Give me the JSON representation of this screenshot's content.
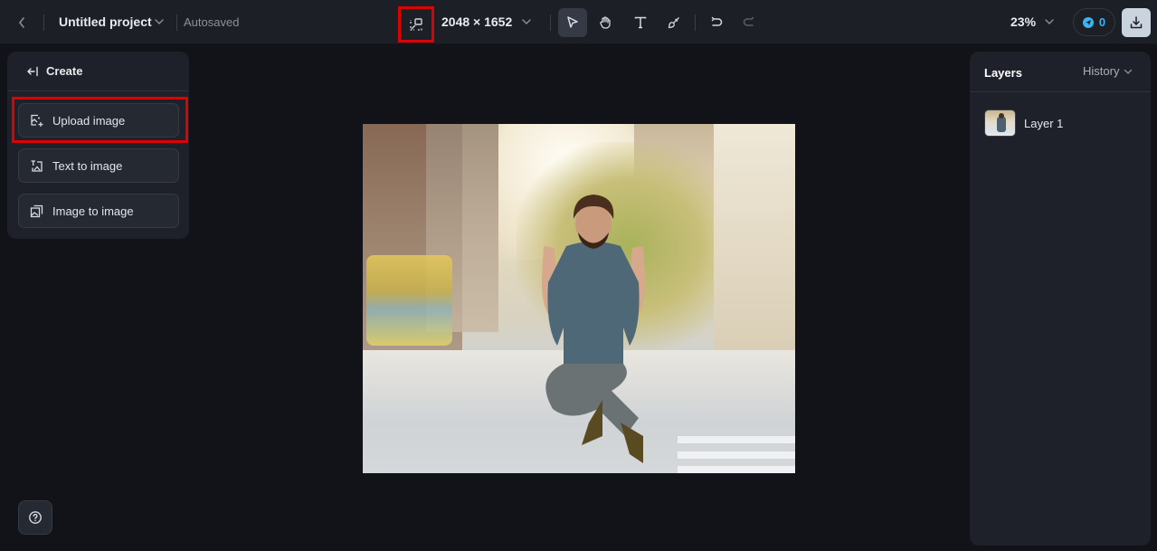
{
  "topbar": {
    "back_icon": "chevron-left-icon",
    "project_title": "Untitled project",
    "save_status": "Autosaved",
    "fit_canvas_icon": "fit-to-screen-icon",
    "canvas_size": "2048 × 1652",
    "tools": [
      {
        "name": "select",
        "icon": "cursor-arrow-icon",
        "active": true
      },
      {
        "name": "pan",
        "icon": "hand-icon",
        "active": false
      },
      {
        "name": "text",
        "icon": "text-t-icon",
        "active": false
      },
      {
        "name": "brush",
        "icon": "brush-icon",
        "active": false
      }
    ],
    "undo_icon": "undo-icon",
    "redo_icon": "redo-icon",
    "zoom_level": "23%",
    "credits": "0",
    "download_icon": "download-icon"
  },
  "create_panel": {
    "title": "Create",
    "items": [
      {
        "label": "Upload image",
        "icon": "upload-image-icon"
      },
      {
        "label": "Text to image",
        "icon": "text-to-image-icon"
      },
      {
        "label": "Image to image",
        "icon": "image-to-image-icon"
      }
    ]
  },
  "layers_panel": {
    "tab_layers": "Layers",
    "tab_history": "History",
    "layers": [
      {
        "name": "Layer 1"
      }
    ]
  },
  "help_icon": "help-circle-icon",
  "colors": {
    "background": "#111318",
    "panel": "#1e2129",
    "topbar": "#1c1f26",
    "highlight": "#e00000",
    "credit_accent": "#3ab4f2",
    "download_bg": "#c9d4de"
  }
}
